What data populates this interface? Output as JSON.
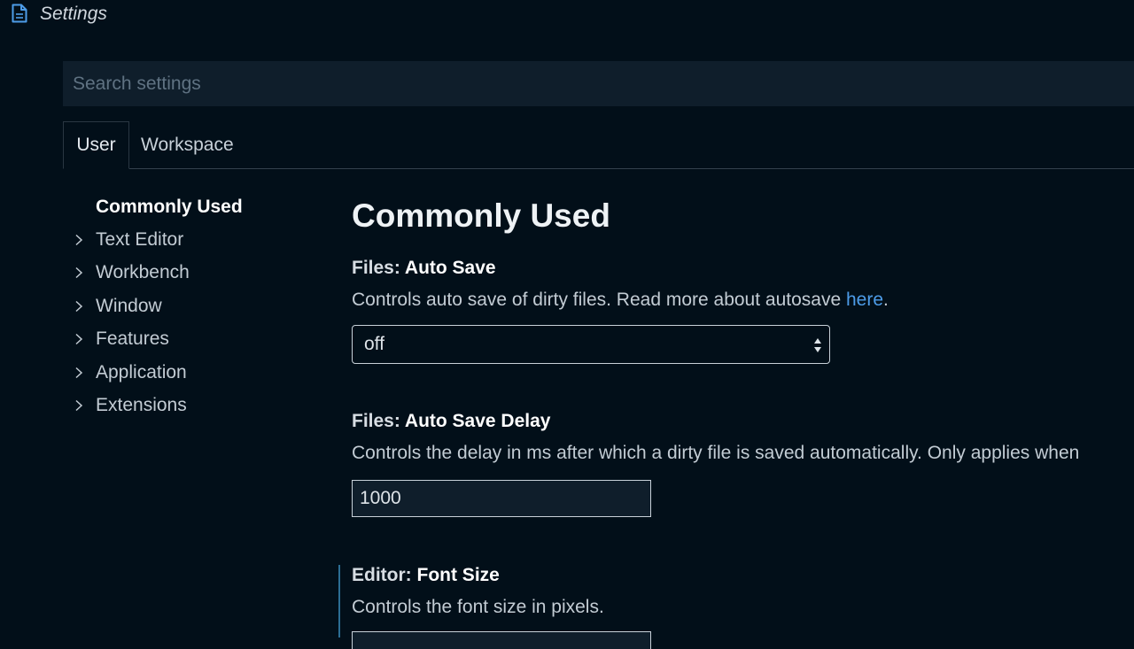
{
  "window": {
    "title": "Settings",
    "title_icon": "file-icon"
  },
  "search": {
    "placeholder": "Search settings",
    "value": ""
  },
  "tabs": [
    {
      "label": "User",
      "active": true
    },
    {
      "label": "Workspace",
      "active": false
    }
  ],
  "toc": {
    "items": [
      {
        "label": "Commonly Used",
        "selected": true,
        "expandable": false
      },
      {
        "label": "Text Editor",
        "selected": false,
        "expandable": true
      },
      {
        "label": "Workbench",
        "selected": false,
        "expandable": true
      },
      {
        "label": "Window",
        "selected": false,
        "expandable": true
      },
      {
        "label": "Features",
        "selected": false,
        "expandable": true
      },
      {
        "label": "Application",
        "selected": false,
        "expandable": true
      },
      {
        "label": "Extensions",
        "selected": false,
        "expandable": true
      }
    ]
  },
  "main": {
    "section_title": "Commonly Used",
    "settings": [
      {
        "category": "Files: ",
        "name": "Auto Save",
        "description": "Controls auto save of dirty files. Read more about autosave ",
        "link_text": "here",
        "description_suffix": ".",
        "control": "select",
        "value": "off"
      },
      {
        "category": "Files: ",
        "name": "Auto Save Delay",
        "description": "Controls the delay in ms after which a dirty file is saved automatically. Only applies when",
        "control": "number",
        "value": "1000"
      },
      {
        "category": "Editor: ",
        "name": "Font Size",
        "description": "Controls the font size in pixels.",
        "control": "number",
        "value": ""
      }
    ]
  },
  "colors": {
    "background": "#020f19",
    "input_background": "#0f1e2b",
    "link": "#4d9ce8",
    "focus_indicator": "#2c6e94"
  }
}
